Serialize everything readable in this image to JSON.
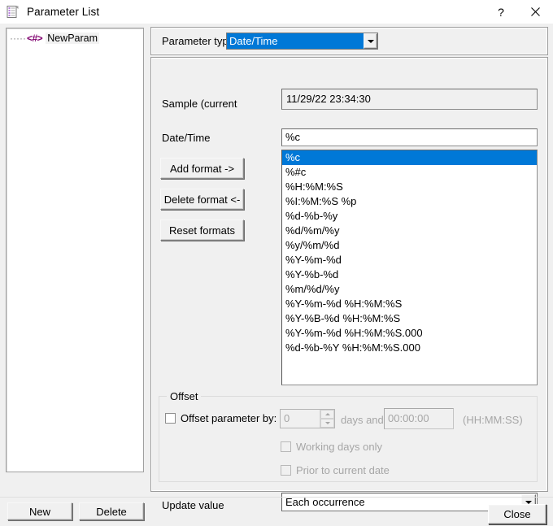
{
  "window": {
    "title": "Parameter List",
    "icon": "parameter-list-icon",
    "help_label": "?",
    "close_label": "✕"
  },
  "tree": {
    "nodes": [
      {
        "dots": "·····",
        "glyph": "<#>",
        "label": "NewParam"
      }
    ]
  },
  "tree_buttons": {
    "new_label": "New",
    "delete_label": "Delete"
  },
  "parameter_type": {
    "label": "Parameter type:",
    "value": "Date/Time",
    "options": [
      "Date/Time"
    ]
  },
  "form": {
    "sample_label": "Sample (current",
    "sample_value": "11/29/22 23:34:30",
    "datetime_label": "Date/Time",
    "datetime_value": "%c"
  },
  "format_buttons": {
    "add_label": "Add format ->",
    "delete_label": "Delete format <-",
    "reset_label": "Reset formats"
  },
  "format_list": {
    "selected_index": 0,
    "items": [
      "%c",
      "%#c",
      "%H:%M:%S",
      "%I:%M:%S %p",
      "%d-%b-%y",
      "%d/%m/%y",
      "%y/%m/%d",
      "%Y-%m-%d",
      "%Y-%b-%d",
      "%m/%d/%y",
      "%Y-%m-%d %H:%M:%S",
      "%Y-%B-%d %H:%M:%S",
      "%Y-%m-%d %H:%M:%S.000",
      "%d-%b-%Y %H:%M:%S.000"
    ]
  },
  "offset": {
    "legend": "Offset",
    "checkbox_label": "Offset parameter by:",
    "days_value": "0",
    "days_label": "days and",
    "time_value": "00:00:00",
    "time_hint": "(HH:MM:SS)",
    "working_days_label": "Working days only",
    "prior_date_label": "Prior to current date"
  },
  "update_value": {
    "label": "Update value",
    "value": "Each occurrence",
    "options": [
      "Each occurrence"
    ]
  },
  "footer": {
    "close_label": "Close"
  },
  "colors": {
    "accent": "#0078d7",
    "window_bg": "#f0f0f0",
    "field_bg": "#ffffff",
    "tree_glyph": "#80006f",
    "disabled_text": "#a6a6a6"
  }
}
